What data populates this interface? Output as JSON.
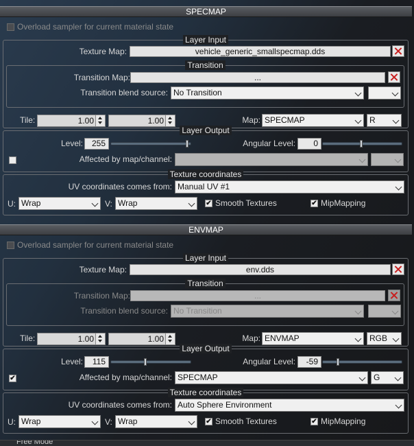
{
  "sections": [
    {
      "title": "SPECMAP",
      "overload_label": "Overload sampler for current material state",
      "layer_input": {
        "legend": "Layer Input",
        "texture_map_label": "Texture Map:",
        "texture_map_value": "vehicle_generic_smallspecmap.dds",
        "transition": {
          "legend": "Transition",
          "transition_map_label": "Transition Map:",
          "transition_map_value": "...",
          "blend_label": "Transition blend source:",
          "blend_value": "No Transition",
          "blend_channel_value": ""
        },
        "tile_label": "Tile:",
        "tile_u": "1.00",
        "tile_v": "1.00",
        "map_label": "Map:",
        "map_value": "SPECMAP",
        "map_channel": "R"
      },
      "layer_output": {
        "legend": "Layer Output",
        "level_label": "Level:",
        "level_value": "255",
        "angular_label": "Angular Level:",
        "angular_value": "0",
        "affected_label": "Affected by map/channel:",
        "affected_value": "",
        "affected_channel": ""
      },
      "tex_coords": {
        "legend": "Texture coordinates",
        "uv_label": "UV coordinates comes from:",
        "uv_value": "Manual UV #1",
        "u_label": "U:",
        "u_value": "Wrap",
        "v_label": "V:",
        "v_value": "Wrap",
        "smooth_label": "Smooth Textures",
        "mip_label": "MipMapping"
      }
    },
    {
      "title": "ENVMAP",
      "overload_label": "Overload sampler for current material state",
      "layer_input": {
        "legend": "Layer Input",
        "texture_map_label": "Texture Map:",
        "texture_map_value": "env.dds",
        "transition": {
          "legend": "Transition",
          "transition_map_label": "Transition Map:",
          "transition_map_value": "...",
          "blend_label": "Transition blend source:",
          "blend_value": "No Transition",
          "blend_channel_value": ""
        },
        "tile_label": "Tile:",
        "tile_u": "1.00",
        "tile_v": "1.00",
        "map_label": "Map:",
        "map_value": "ENVMAP",
        "map_channel": "RGB"
      },
      "layer_output": {
        "legend": "Layer Output",
        "level_label": "Level:",
        "level_value": "115",
        "angular_label": "Angular Level:",
        "angular_value": "-59",
        "affected_label": "Affected by map/channel:",
        "affected_value": "SPECMAP",
        "affected_channel": "G"
      },
      "tex_coords": {
        "legend": "Texture coordinates",
        "uv_label": "UV coordinates comes from:",
        "uv_value": "Auto Sphere Environment",
        "u_label": "U:",
        "u_value": "Wrap",
        "v_label": "V:",
        "v_value": "Wrap",
        "smooth_label": "Smooth Textures",
        "mip_label": "MipMapping"
      }
    }
  ],
  "footer_text": "Free Mode",
  "checkmark": "✔",
  "colors": {
    "title_bar": "#4a4d52",
    "clear_icon": "#c81e1e",
    "panel_bg": "#1f2124"
  }
}
